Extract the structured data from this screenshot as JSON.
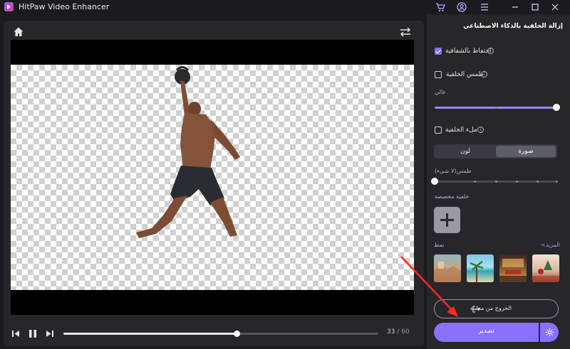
{
  "app": {
    "title": "HitPaw Video Enhancer"
  },
  "titlebar": {
    "icons": [
      "cart-icon",
      "account-icon",
      "menu-icon"
    ],
    "controls": [
      "minimize-icon",
      "maximize-icon",
      "close-icon"
    ],
    "icon_color": "#b9a8ff"
  },
  "player": {
    "current_time": "33",
    "separator": " / ",
    "total_time": "60",
    "progress": 0.55,
    "icons": [
      "home-icon",
      "compare-icon",
      "previous-frame-icon",
      "pause-icon",
      "next-frame-icon"
    ]
  },
  "panel": {
    "title": "إزالة الخلفية بالذكاء الاصطناعي",
    "keep_transparency": {
      "label": "احتفاظ بالشفافية",
      "checked": true
    },
    "blur_background": {
      "label": "طمس الخلفية",
      "checked": false,
      "level_label": "عالي",
      "level": 1.0
    },
    "fill_background": {
      "label": "ملء الخلفية",
      "checked": false
    },
    "fill_tabs": [
      {
        "label": "صورة",
        "active": true
      },
      {
        "label": "لون",
        "active": false
      }
    ],
    "fill_blur_label": "طمس(لا شيء)",
    "fill_blur_level": 0.0,
    "custom_bg_label": "خلفية مخصصة",
    "style_label": "نمط",
    "more_link": "المزيد>",
    "exit_preview_label": "الخروج من معاينة",
    "export_label": "تصدير",
    "accent_color": "#8b6fff"
  }
}
